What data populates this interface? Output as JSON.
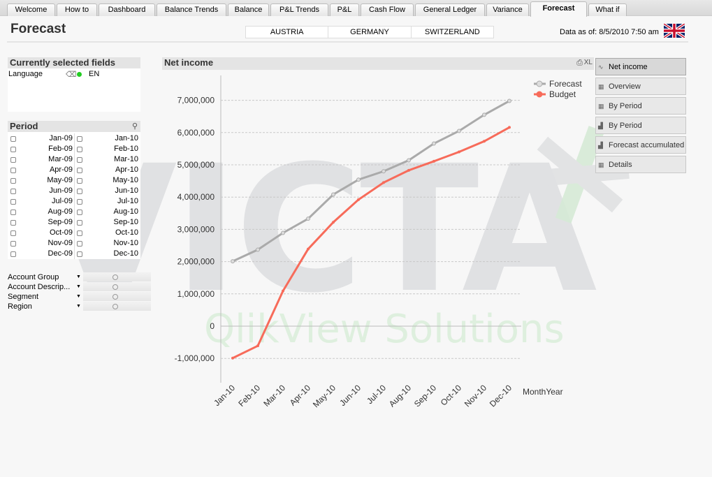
{
  "tabs": [
    {
      "label": "Welcome"
    },
    {
      "label": "How to"
    },
    {
      "label": "Dashboard"
    },
    {
      "label": "Balance Trends"
    },
    {
      "label": "Balance"
    },
    {
      "label": "P&L Trends"
    },
    {
      "label": "P&L"
    },
    {
      "label": "Cash Flow"
    },
    {
      "label": "General Ledger"
    },
    {
      "label": "Variance"
    },
    {
      "label": "Forecast",
      "active": true
    },
    {
      "label": "What if"
    }
  ],
  "page_title": "Forecast",
  "countries": [
    "AUSTRIA",
    "GERMANY",
    "SWITZERLAND"
  ],
  "data_as_of": "Data as of: 8/5/2010 7:50 am",
  "language_flag": "uk-flag-icon",
  "watermark": {
    "logo": "VICTA",
    "subtitle": "QlikView Solutions"
  },
  "selected_fields": {
    "title": "Currently selected fields",
    "items": [
      {
        "field": "Language",
        "value": "EN"
      }
    ]
  },
  "period": {
    "title": "Period",
    "col1": [
      "Jan-09",
      "Feb-09",
      "Mar-09",
      "Apr-09",
      "May-09",
      "Jun-09",
      "Jul-09",
      "Aug-09",
      "Sep-09",
      "Oct-09",
      "Nov-09",
      "Dec-09"
    ],
    "col2": [
      "Jan-10",
      "Feb-10",
      "Mar-10",
      "Apr-10",
      "May-10",
      "Jun-10",
      "Jul-10",
      "Aug-10",
      "Sep-10",
      "Oct-10",
      "Nov-10",
      "Dec-10"
    ]
  },
  "multibox": [
    "Account Group",
    "Account Descrip...",
    "Segment",
    "Region"
  ],
  "chart": {
    "caption": "Net income",
    "xl_label": "XL"
  },
  "buttons": [
    {
      "label": "Net income",
      "icon": "line-chart-icon",
      "selected": true
    },
    {
      "label": "Overview",
      "icon": "table-icon"
    },
    {
      "label": "By Period",
      "icon": "table-icon"
    },
    {
      "label": "By Period",
      "icon": "bar-chart-icon"
    },
    {
      "label": "Forecast accumulated",
      "icon": "bar-chart-icon"
    },
    {
      "label": "Details",
      "icon": "table-icon"
    }
  ],
  "chart_data": {
    "type": "line",
    "xlabel": "MonthYear",
    "categories": [
      "Jan-10",
      "Feb-10",
      "Mar-10",
      "Apr-10",
      "May-10",
      "Jun-10",
      "Jul-10",
      "Aug-10",
      "Sep-10",
      "Oct-10",
      "Nov-10",
      "Dec-10"
    ],
    "yticks": [
      "7,000,000",
      "6,000,000",
      "5,000,000",
      "4,000,000",
      "3,000,000",
      "2,000,000",
      "1,000,000",
      "0",
      "-1,000,000"
    ],
    "ylim": [
      -1500000,
      7800000
    ],
    "grid": true,
    "legend_position": "top-right",
    "series": [
      {
        "name": "Forecast",
        "color": "#aaaaaa",
        "values": [
          2010000,
          2370000,
          2890000,
          3330000,
          4080000,
          4540000,
          4800000,
          5140000,
          5660000,
          6050000,
          6550000,
          6980000
        ]
      },
      {
        "name": "Budget",
        "color": "#f76b5a",
        "values": [
          -990000,
          -610000,
          1090000,
          2390000,
          3220000,
          3920000,
          4450000,
          4830000,
          5110000,
          5400000,
          5730000,
          6160000
        ]
      }
    ]
  }
}
